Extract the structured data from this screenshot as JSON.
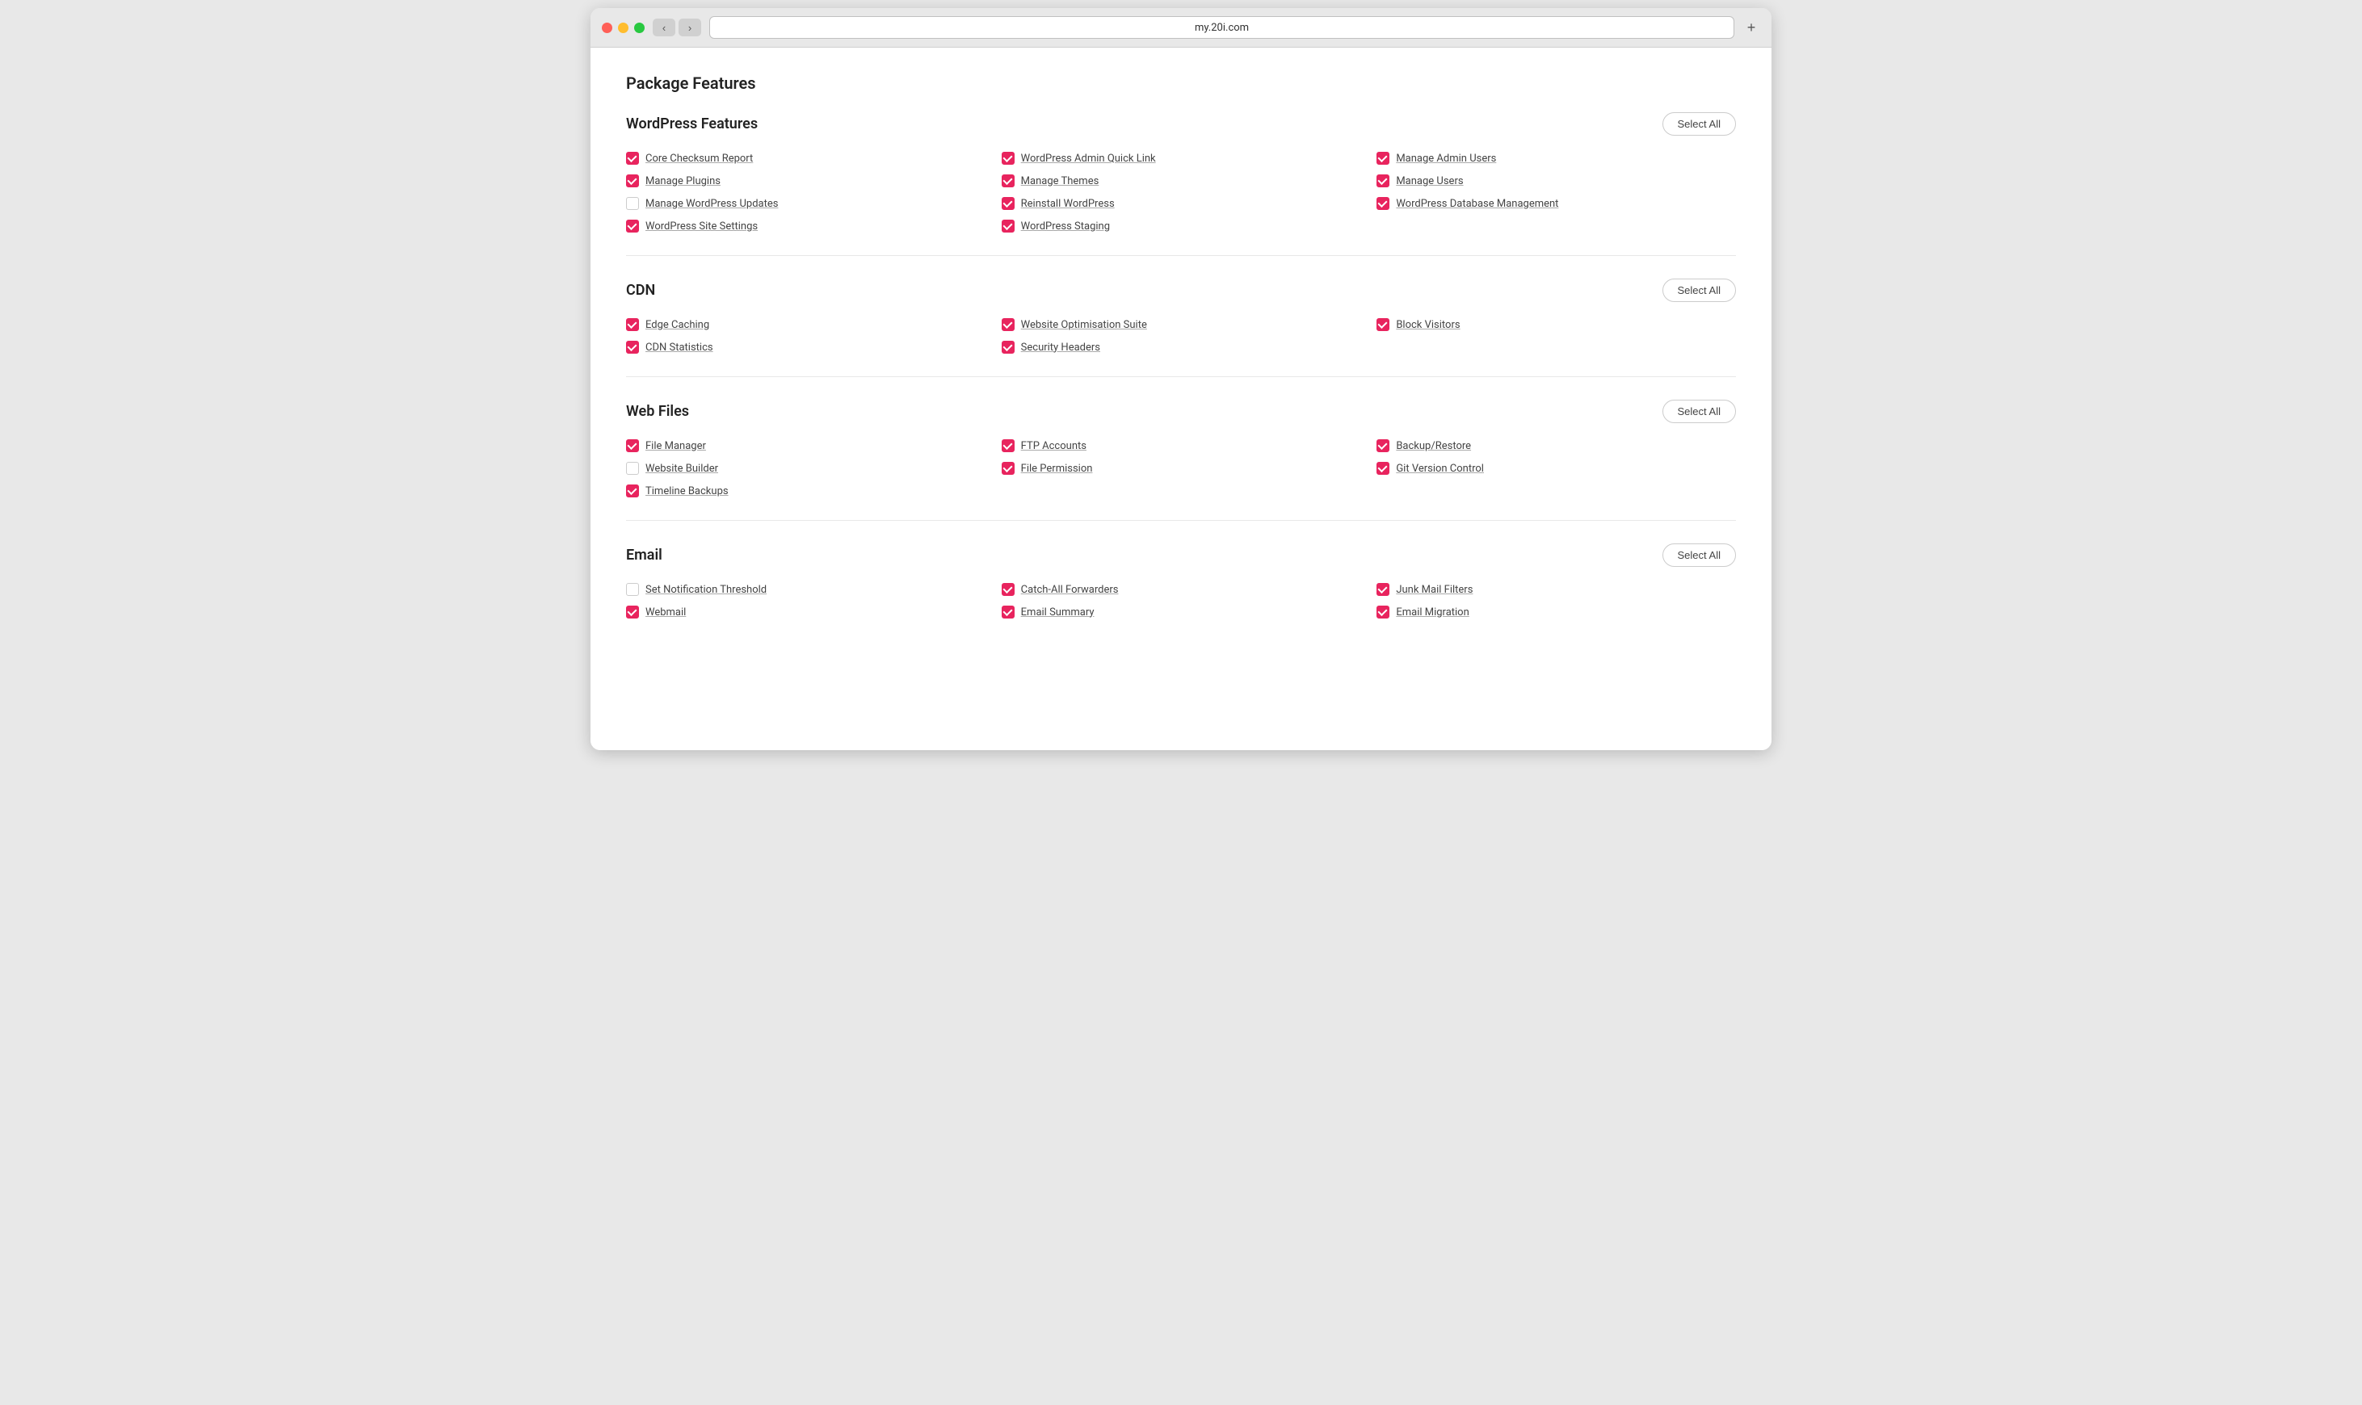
{
  "browser": {
    "url": "my.20i.com",
    "nav_back": "‹",
    "nav_forward": "›",
    "new_tab": "+"
  },
  "page": {
    "title": "Package Features"
  },
  "sections": [
    {
      "id": "wordpress",
      "title": "WordPress Features",
      "select_all_label": "Select All",
      "features": [
        {
          "label": "Core Checksum Report",
          "checked": true
        },
        {
          "label": "WordPress Admin Quick Link",
          "checked": true
        },
        {
          "label": "Manage Admin Users",
          "checked": true
        },
        {
          "label": "Manage Plugins",
          "checked": true
        },
        {
          "label": "Manage Themes",
          "checked": true
        },
        {
          "label": "Manage Users",
          "checked": true
        },
        {
          "label": "Manage WordPress Updates",
          "checked": false
        },
        {
          "label": "Reinstall WordPress",
          "checked": true
        },
        {
          "label": "WordPress Database Management",
          "checked": true
        },
        {
          "label": "WordPress Site Settings",
          "checked": true
        },
        {
          "label": "WordPress Staging",
          "checked": true
        }
      ]
    },
    {
      "id": "cdn",
      "title": "CDN",
      "select_all_label": "Select All",
      "features": [
        {
          "label": "Edge Caching",
          "checked": true
        },
        {
          "label": "Website Optimisation Suite",
          "checked": true
        },
        {
          "label": "Block Visitors",
          "checked": true
        },
        {
          "label": "CDN Statistics",
          "checked": true
        },
        {
          "label": "Security Headers",
          "checked": true
        }
      ]
    },
    {
      "id": "webfiles",
      "title": "Web Files",
      "select_all_label": "Select All",
      "features": [
        {
          "label": "File Manager",
          "checked": true
        },
        {
          "label": "FTP Accounts",
          "checked": true
        },
        {
          "label": "Backup/Restore",
          "checked": true
        },
        {
          "label": "Website Builder",
          "checked": false
        },
        {
          "label": "File Permission",
          "checked": true
        },
        {
          "label": "Git Version Control",
          "checked": true
        },
        {
          "label": "Timeline Backups",
          "checked": true
        }
      ]
    },
    {
      "id": "email",
      "title": "Email",
      "select_all_label": "Select All",
      "features": [
        {
          "label": "Set Notification Threshold",
          "checked": false
        },
        {
          "label": "Catch-All Forwarders",
          "checked": true
        },
        {
          "label": "Junk Mail Filters",
          "checked": true
        },
        {
          "label": "Webmail",
          "checked": true
        },
        {
          "label": "Email Summary",
          "checked": true
        },
        {
          "label": "Email Migration",
          "checked": true
        }
      ]
    }
  ]
}
